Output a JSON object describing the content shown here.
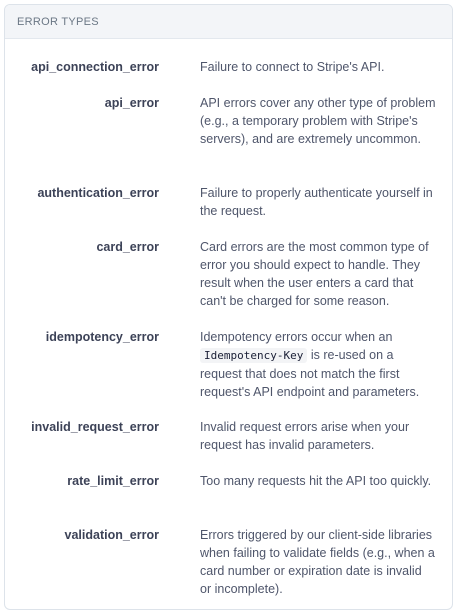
{
  "header": {
    "title": "ERROR TYPES"
  },
  "error_types": [
    {
      "name": "api_connection_error",
      "description": "Failure to connect to Stripe's API."
    },
    {
      "name": "api_error",
      "description": "API errors cover any other type of problem (e.g., a temporary problem with Stripe's servers), and are extremely uncommon."
    },
    {
      "name": "authentication_error",
      "description": "Failure to properly authenticate yourself in the request."
    },
    {
      "name": "card_error",
      "description": "Card errors are the most common type of error you should expect to handle. They result when the user enters a card that can't be charged for some reason."
    },
    {
      "name": "idempotency_error",
      "description_prefix": "Idempotency errors occur when an",
      "description_code": "Idempotency-Key",
      "description_suffix": "is re-used on a request that does not match the first request's API endpoint and parameters."
    },
    {
      "name": "invalid_request_error",
      "description": "Invalid request errors arise when your request has invalid parameters."
    },
    {
      "name": "rate_limit_error",
      "description": "Too many requests hit the API too quickly."
    },
    {
      "name": "validation_error",
      "description": "Errors triggered by our client-side libraries when failing to validate fields (e.g., when a card number or expiration date is invalid or incomplete)."
    }
  ]
}
